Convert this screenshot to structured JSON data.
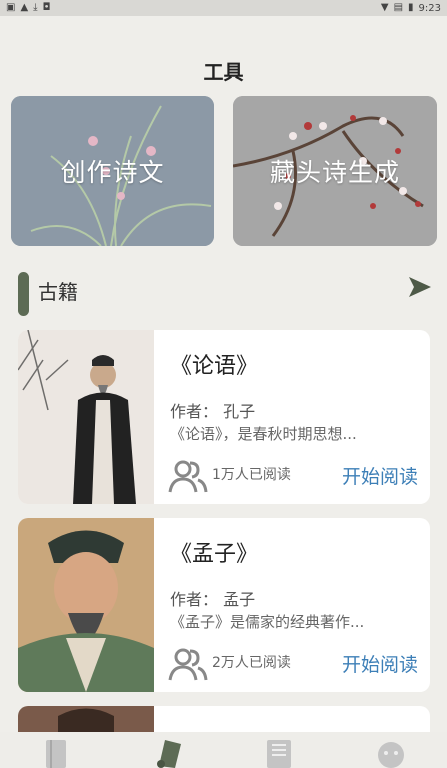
{
  "statusbar": {
    "time": "9:23"
  },
  "page_title": "工具",
  "tools": [
    {
      "label": "创作诗文"
    },
    {
      "label": "藏头诗生成"
    }
  ],
  "section": {
    "title": "古籍"
  },
  "books": [
    {
      "title": "《论语》",
      "author": "作者：  孔子",
      "desc": "《论语》，是春秋时期思想...",
      "readers": "1万人已阅读",
      "action": "开始阅读"
    },
    {
      "title": "《孟子》",
      "author": "作者：  孟子",
      "desc": "《孟子》是儒家的经典著作...",
      "readers": "2万人已阅读",
      "action": "开始阅读"
    }
  ],
  "tabs": [
    {
      "icon": "book-icon"
    },
    {
      "icon": "scroll-icon"
    },
    {
      "icon": "document-icon"
    },
    {
      "icon": "face-icon"
    }
  ],
  "colors": {
    "accent": "#3d7fb7",
    "section_bar": "#5d6b55"
  }
}
